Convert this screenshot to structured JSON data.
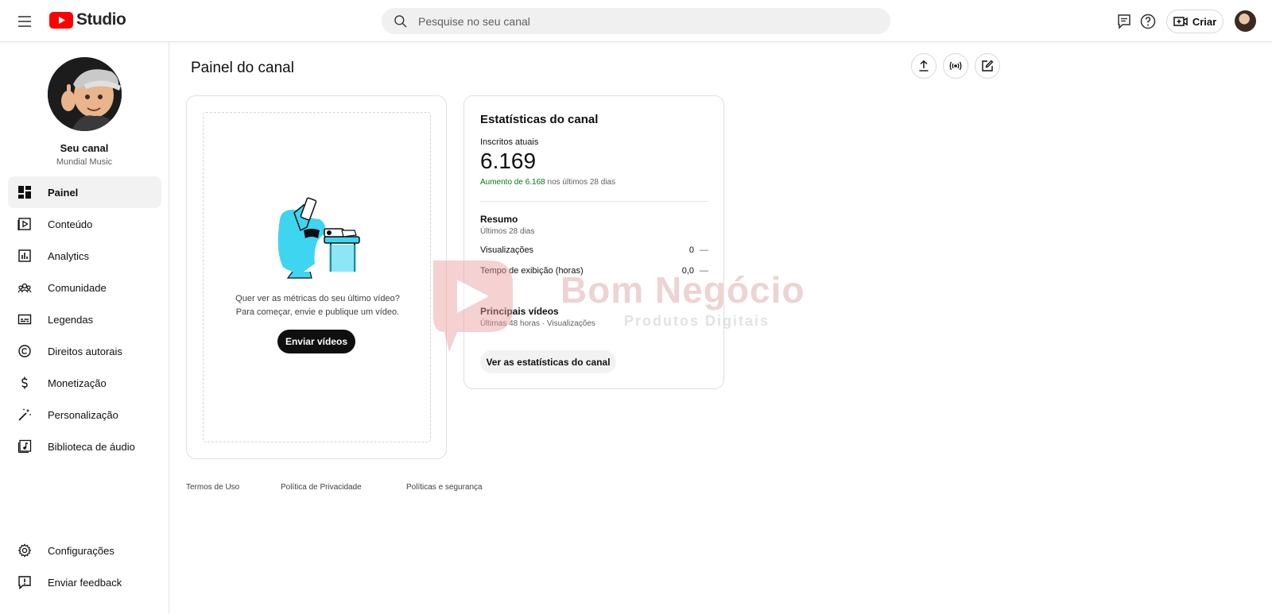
{
  "app": {
    "logo_text": "Studio",
    "brand_color": "#ff0000"
  },
  "search": {
    "placeholder": "Pesquise no seu canal"
  },
  "topbar": {
    "create_label": "Criar"
  },
  "channel": {
    "title": "Seu canal",
    "name": "Mundial Music"
  },
  "sidebar": {
    "items": [
      {
        "label": "Painel",
        "icon": "dashboard-icon",
        "active": true
      },
      {
        "label": "Conteúdo",
        "icon": "content-icon"
      },
      {
        "label": "Analytics",
        "icon": "analytics-icon"
      },
      {
        "label": "Comunidade",
        "icon": "community-icon"
      },
      {
        "label": "Legendas",
        "icon": "subtitles-icon"
      },
      {
        "label": "Direitos autorais",
        "icon": "copyright-icon"
      },
      {
        "label": "Monetização",
        "icon": "dollar-icon"
      },
      {
        "label": "Personalização",
        "icon": "magic-wand-icon"
      },
      {
        "label": "Biblioteca de áudio",
        "icon": "audio-library-icon"
      }
    ],
    "bottom_items": [
      {
        "label": "Configurações",
        "icon": "gear-icon"
      },
      {
        "label": "Enviar feedback",
        "icon": "feedback-icon"
      }
    ]
  },
  "main": {
    "title": "Painel do canal",
    "upload_card": {
      "line1": "Quer ver as métricas do seu último vídeo?",
      "line2": "Para começar, envie e publique um vídeo.",
      "button": "Enviar vídeos"
    },
    "stats_card": {
      "title": "Estatísticas do canal",
      "subs_label": "Inscritos atuais",
      "subs_value": "6.169",
      "subs_change_highlight": "Aumento de 6.168",
      "subs_change_rest": " nos últimos 28 dias",
      "summary_title": "Resumo",
      "summary_period": "Últimos 28 dias",
      "metrics": [
        {
          "name": "Visualizações",
          "value": "0",
          "trend": "—"
        },
        {
          "name": "Tempo de exibição (horas)",
          "value": "0,0",
          "trend": "—"
        }
      ],
      "top_videos_title": "Principais vídeos",
      "top_videos_sub": "Últimas 48 horas · Visualizações",
      "button": "Ver as estatísticas do canal"
    }
  },
  "footer": {
    "links": [
      "Termos de Uso",
      "Política de Privacidade",
      "Políticas e segurança"
    ]
  },
  "watermark": {
    "title": "Bom Negócio",
    "subtitle": "Produtos Digitais"
  }
}
